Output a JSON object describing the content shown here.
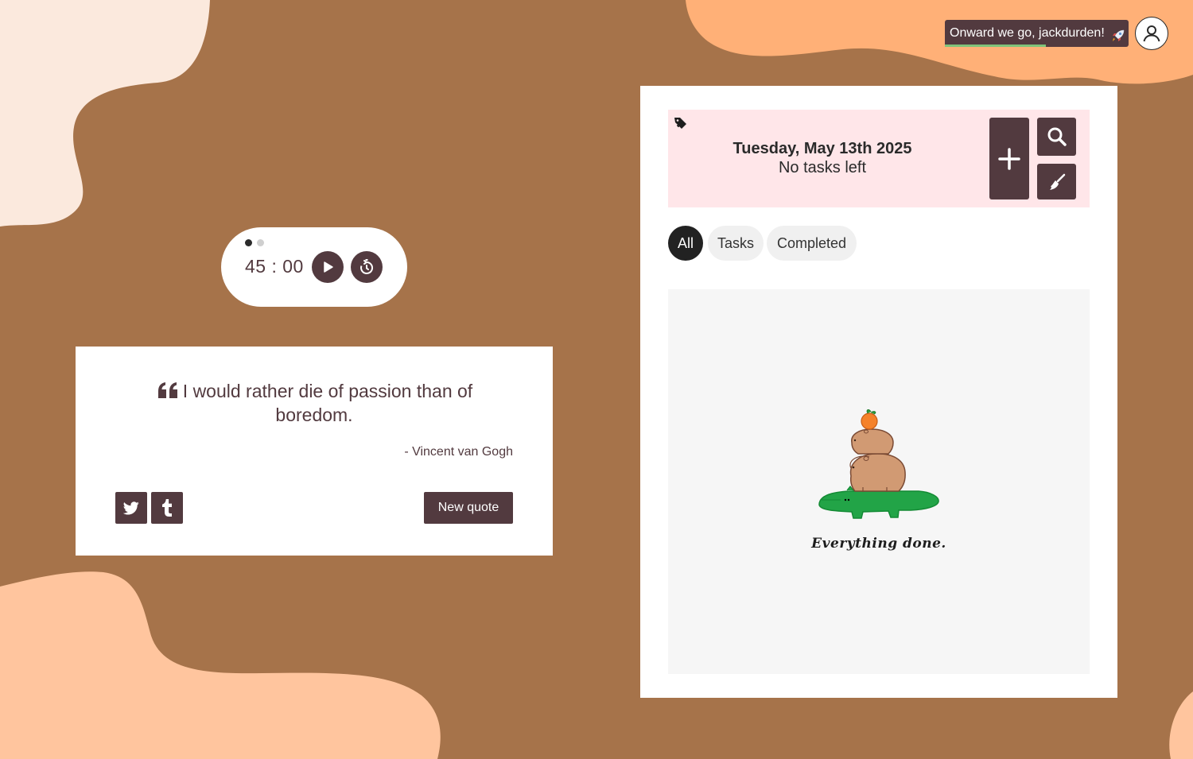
{
  "colors": {
    "background": "#a6734a",
    "accent": "#523a3f",
    "blob_light": "#fbe9dd",
    "blob_peach": "#ffb077",
    "blob_salmon": "#ffc59e",
    "header_pink": "#ffe6e9"
  },
  "header": {
    "greeting": "Onward we go, jackdurden!",
    "greeting_progress": 0.55,
    "greeting_icon": "rocket-icon",
    "avatar_icon": "user-icon"
  },
  "timer": {
    "time": "45 : 00",
    "pages": 2,
    "active_page": 1,
    "play_icon": "play-icon",
    "reset_icon": "timer-reset-icon"
  },
  "quote": {
    "text": "I would rather die of passion than of boredom.",
    "author": "- Vincent van Gogh",
    "quote_icon": "quote-icon",
    "share_icons": [
      "twitter-icon",
      "tumblr-icon"
    ],
    "new_quote_label": "New quote"
  },
  "todo": {
    "date": "Tuesday, May 13th 2025",
    "status": "No tasks left",
    "tag_icon": "tag-add-icon",
    "add_icon": "plus-icon",
    "search_icon": "search-icon",
    "clear_icon": "broom-icon",
    "filters": [
      "All",
      "Tasks",
      "Completed"
    ],
    "active_filter": "All",
    "empty_message": "Everything done.",
    "empty_illustration": "capybaras-on-crocodile-illustration"
  }
}
